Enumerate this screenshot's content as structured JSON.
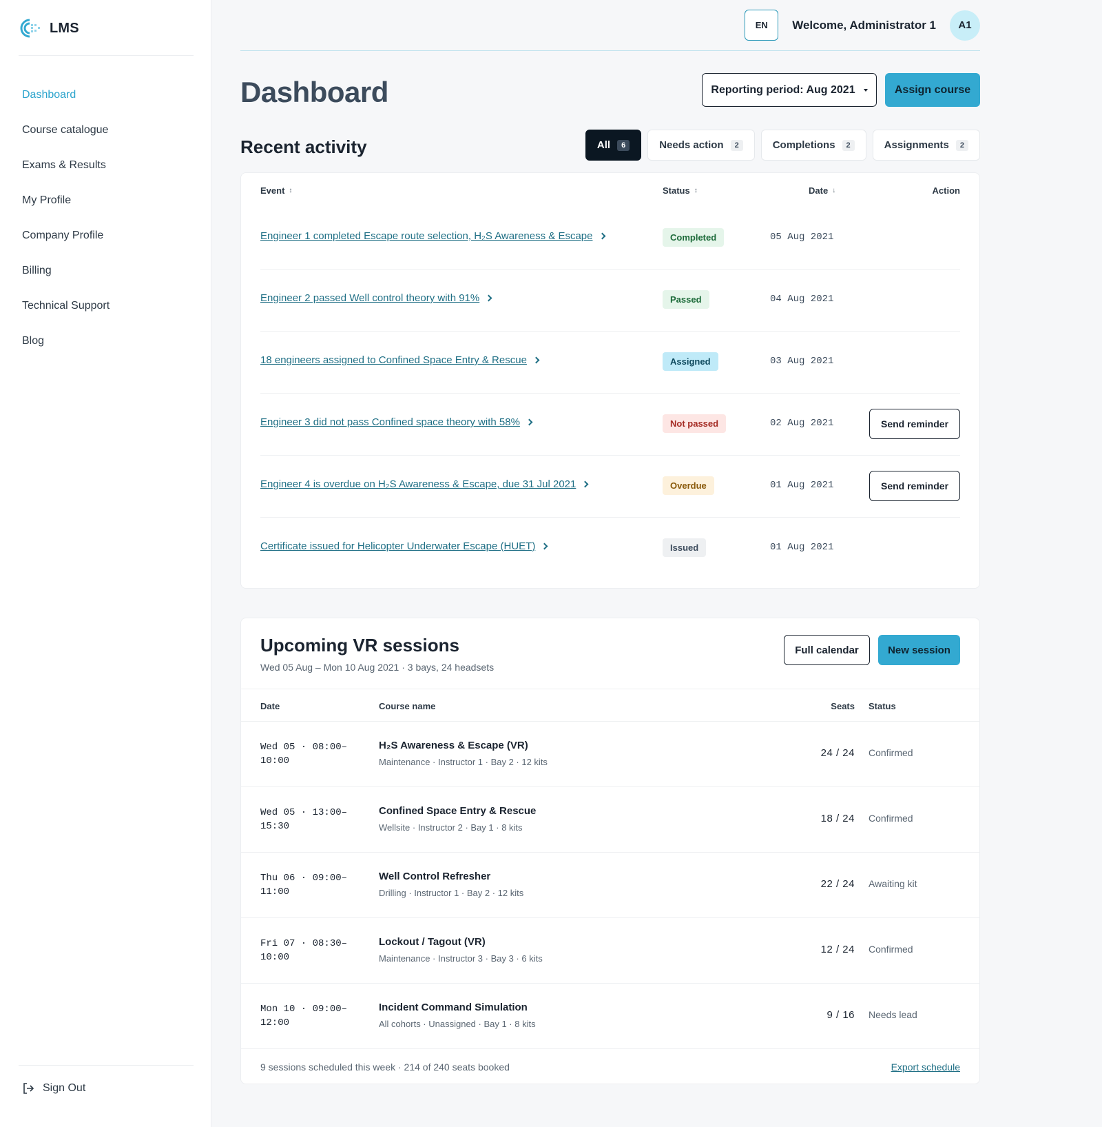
{
  "app": {
    "name": "LMS"
  },
  "sidebar": {
    "items": [
      {
        "label": "Dashboard",
        "active": true
      },
      {
        "label": "Course catalogue"
      },
      {
        "label": "Exams & Results"
      },
      {
        "label": "My Profile"
      },
      {
        "label": "Company Profile"
      },
      {
        "label": "Billing"
      },
      {
        "label": "Technical Support"
      },
      {
        "label": "Blog"
      }
    ],
    "signout_label": "Sign Out"
  },
  "topbar": {
    "language": "EN",
    "welcome": "Welcome, Administrator 1",
    "avatar_initials": "A1"
  },
  "page": {
    "title": "Dashboard",
    "period_label": "Reporting period: Aug 2021",
    "assign_label": "Assign course"
  },
  "activity": {
    "title": "Recent activity",
    "filters": [
      {
        "label": "All",
        "count": "6",
        "active": true
      },
      {
        "label": "Needs action",
        "count": "2"
      },
      {
        "label": "Completions",
        "count": "2"
      },
      {
        "label": "Assignments",
        "count": "2"
      }
    ],
    "columns": {
      "event": "Event",
      "status": "Status",
      "date": "Date",
      "action": "Action"
    },
    "rows": [
      {
        "event": "Engineer 1 completed Escape route selection, H₂S Awareness & Escape",
        "status": "Completed",
        "date": "05 Aug 2021",
        "action": ""
      },
      {
        "event": "Engineer 2 passed Well control theory with 91%",
        "status": "Passed",
        "date": "04 Aug 2021",
        "action": ""
      },
      {
        "event": "18 engineers assigned to Confined Space Entry & Rescue",
        "status": "Assigned",
        "date": "03 Aug 2021",
        "action": ""
      },
      {
        "event": "Engineer 3 did not pass Confined space theory with 58%",
        "status": "Not passed",
        "date": "02 Aug 2021",
        "action": "Send reminder"
      },
      {
        "event": "Engineer 4 is overdue on H₂S Awareness & Escape, due 31 Jul 2021",
        "status": "Overdue",
        "date": "01 Aug 2021",
        "action": "Send reminder"
      },
      {
        "event": "Certificate issued for Helicopter Underwater Escape (HUET)",
        "status": "Issued",
        "date": "01 Aug 2021",
        "action": ""
      }
    ]
  },
  "sessions": {
    "title": "Upcoming VR sessions",
    "subtitle": "Wed 05 Aug – Mon 10 Aug 2021 · 3 bays, 24 headsets",
    "calendar_label": "Full calendar",
    "new_label": "New session",
    "columns": {
      "date": "Date",
      "course": "Course name",
      "seats": "Seats",
      "status": "Status"
    },
    "rows": [
      {
        "date": "Wed 05 · 08:00–10:00",
        "course": "H₂S Awareness & Escape (VR)",
        "meta": "Maintenance · Instructor 1 · Bay 2 · 12 kits",
        "seats": "24 / 24",
        "status": "Confirmed"
      },
      {
        "date": "Wed 05 · 13:00–15:30",
        "course": "Confined Space Entry & Rescue",
        "meta": "Wellsite · Instructor 2 · Bay 1 · 8 kits",
        "seats": "18 / 24",
        "status": "Confirmed"
      },
      {
        "date": "Thu 06 · 09:00–11:00",
        "course": "Well Control Refresher",
        "meta": "Drilling · Instructor 1 · Bay 2 · 12 kits",
        "seats": "22 / 24",
        "status": "Awaiting kit"
      },
      {
        "date": "Fri 07 · 08:30–10:00",
        "course": "Lockout / Tagout (VR)",
        "meta": "Maintenance · Instructor 3 · Bay 3 · 6 kits",
        "seats": "12 / 24",
        "status": "Confirmed"
      },
      {
        "date": "Mon 10 · 09:00–12:00",
        "course": "Incident Command Simulation",
        "meta": "All cohorts · Unassigned · Bay 1 · 8 kits",
        "seats": "9 / 16",
        "status": "Needs lead"
      }
    ],
    "footer": "9 sessions scheduled this week · 214 of 240 seats booked",
    "export_label": "Export schedule"
  },
  "colors": {
    "accent": "#33a9d1",
    "link": "#1f6f85",
    "dark": "#0b1722"
  }
}
